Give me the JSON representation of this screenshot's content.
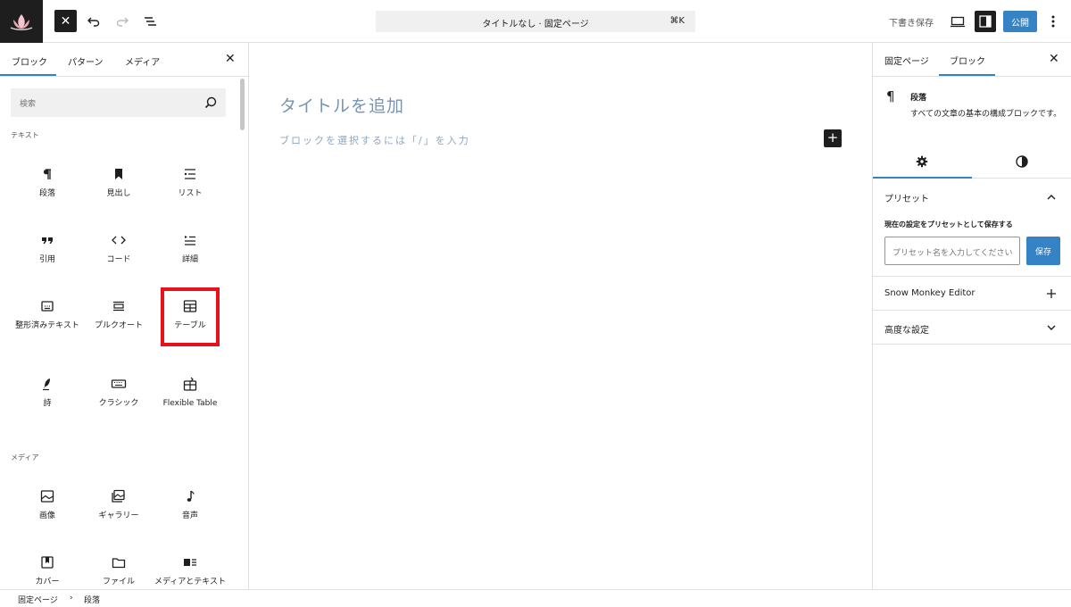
{
  "topbar": {
    "document_title": "タイトルなし · 固定ページ",
    "shortcut": "⌘K",
    "save_draft": "下書き保存",
    "publish": "公開"
  },
  "inserter": {
    "tabs": [
      "ブロック",
      "パターン",
      "メディア"
    ],
    "search_placeholder": "検索",
    "categories": {
      "text": "テキスト",
      "media": "メディア"
    },
    "text_blocks": [
      {
        "label": "段落",
        "icon": "paragraph-icon"
      },
      {
        "label": "見出し",
        "icon": "heading-icon"
      },
      {
        "label": "リスト",
        "icon": "list-icon"
      },
      {
        "label": "引用",
        "icon": "quote-icon"
      },
      {
        "label": "コード",
        "icon": "code-icon"
      },
      {
        "label": "詳細",
        "icon": "details-icon"
      },
      {
        "label": "整形済みテキスト",
        "icon": "preformatted-icon"
      },
      {
        "label": "プルクオート",
        "icon": "pullquote-icon"
      },
      {
        "label": "テーブル",
        "icon": "table-icon"
      },
      {
        "label": "詩",
        "icon": "verse-icon"
      },
      {
        "label": "クラシック",
        "icon": "classic-icon"
      },
      {
        "label": "Flexible Table",
        "icon": "flexible-table-icon"
      }
    ],
    "media_blocks": [
      {
        "label": "画像",
        "icon": "image-icon"
      },
      {
        "label": "ギャラリー",
        "icon": "gallery-icon"
      },
      {
        "label": "音声",
        "icon": "audio-icon"
      },
      {
        "label": "カバー",
        "icon": "cover-icon"
      },
      {
        "label": "ファイル",
        "icon": "file-icon"
      },
      {
        "label": "メディアとテキスト",
        "icon": "media-text-icon"
      }
    ]
  },
  "canvas": {
    "title_placeholder": "タイトルを追加",
    "paragraph_placeholder": "ブロックを選択するには「/」を入力"
  },
  "settings": {
    "tabs": [
      "固定ページ",
      "ブロック"
    ],
    "block_name": "段落",
    "block_description": "すべての文章の基本の構成ブロックです。",
    "preset_section": "プリセット",
    "preset_label": "現在の設定をプリセットとして保存する",
    "preset_placeholder": "プリセット名を入力してください",
    "preset_save": "保存",
    "snow_monkey": "Snow Monkey Editor",
    "advanced": "高度な設定"
  },
  "breadcrumb": [
    "固定ページ",
    "段落"
  ],
  "colors": {
    "accent": "#3582c4",
    "highlight": "#e8111a",
    "dark": "#1e1e1e"
  }
}
